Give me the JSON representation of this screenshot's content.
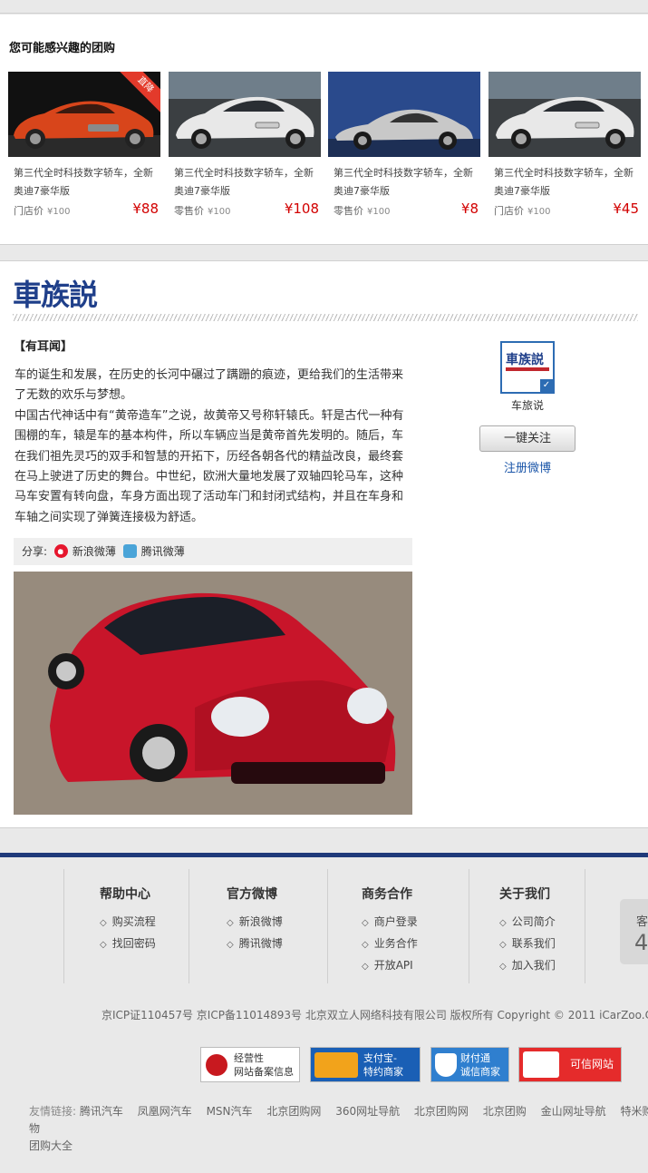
{
  "group_buy": {
    "title": "您可能感兴趣的团购",
    "items": [
      {
        "desc": "第三代全时科技数字轿车，全新奥迪7豪华版",
        "price_label": "门店价",
        "orig_price": "¥100",
        "price": "¥88",
        "ribbon": "直降"
      },
      {
        "desc": "第三代全时科技数字轿车，全新奥迪7豪华版",
        "price_label": "零售价",
        "orig_price": "¥100",
        "price": "¥108"
      },
      {
        "desc": "第三代全时科技数字轿车，全新奥迪7豪华版",
        "price_label": "零售价",
        "orig_price": "¥100",
        "price": "¥8"
      },
      {
        "desc": "第三代全时科技数字轿车，全新奥迪7豪华版",
        "price_label": "门店价",
        "orig_price": "¥100",
        "price": "¥45"
      }
    ]
  },
  "article": {
    "logo": "車族説",
    "heading": "【有耳闻】",
    "paragraphs": [
      "车的诞生和发展，在历史的长河中碾过了蹒跚的痕迹，更给我们的生活带来了无数的欢乐与梦想。",
      "中国古代神话中有“黄帝造车”之说，故黄帝又号称轩辕氏。轩是古代一种有围棚的车，辕是车的基本构件，所以车辆应当是黄帝首先发明的。随后，车在我们祖先灵巧的双手和智慧的开拓下，历经各朝各代的精益改良，最终套在马上驶进了历史的舞台。中世纪，欧洲大量地发展了双轴四轮马车，这种马车安置有转向盘，车身方面出现了活动车门和封闭式结构，并且在车身和车轴之间实现了弹簧连接极为舒适。"
    ],
    "share_label": "分享:",
    "share_sina": "新浪微薄",
    "share_tencent": "腾讯微薄"
  },
  "sidebar": {
    "avatar_text": "車族説",
    "name": "车旅说",
    "follow_button": "一键关注",
    "register_link": "注册微博"
  },
  "footer": {
    "columns": [
      {
        "title": "帮助中心",
        "links": [
          "购买流程",
          "找回密码"
        ]
      },
      {
        "title": "官方微博",
        "links": [
          "新浪微博",
          "腾讯微博"
        ]
      },
      {
        "title": "商务合作",
        "links": [
          "商户登录",
          "业务合作",
          "开放API"
        ]
      },
      {
        "title": "关于我们",
        "links": [
          "公司简介",
          "联系我们",
          "加入我们"
        ]
      }
    ],
    "service_text": "客",
    "service_number": "4",
    "copyright": "京ICP证110457号   京ICP备11014893号   北京双立人网络科技有限公司   版权所有 Copyright © 2011   iCarZoo.C",
    "badges": [
      {
        "line1": "经营性",
        "line2": "网站备案信息"
      },
      {
        "line1": "支付宝-",
        "line2": "特约商家"
      },
      {
        "line1": "财付通",
        "line2": "诚信商家"
      },
      {
        "line1": "可信网站",
        "line2": ""
      }
    ],
    "friend_label": "友情链接:",
    "friend_links": [
      "腾讯汽车",
      "凤凰网汽车",
      "MSN汽车",
      "北京团购网",
      "360网址导航",
      "北京团购网",
      "北京团购",
      "金山网址导航",
      "特米购物",
      "团购大全"
    ]
  },
  "colors": {
    "brand_blue": "#1f3f8a",
    "price_red": "#d20000",
    "footer_rule": "#1f3a7a"
  }
}
